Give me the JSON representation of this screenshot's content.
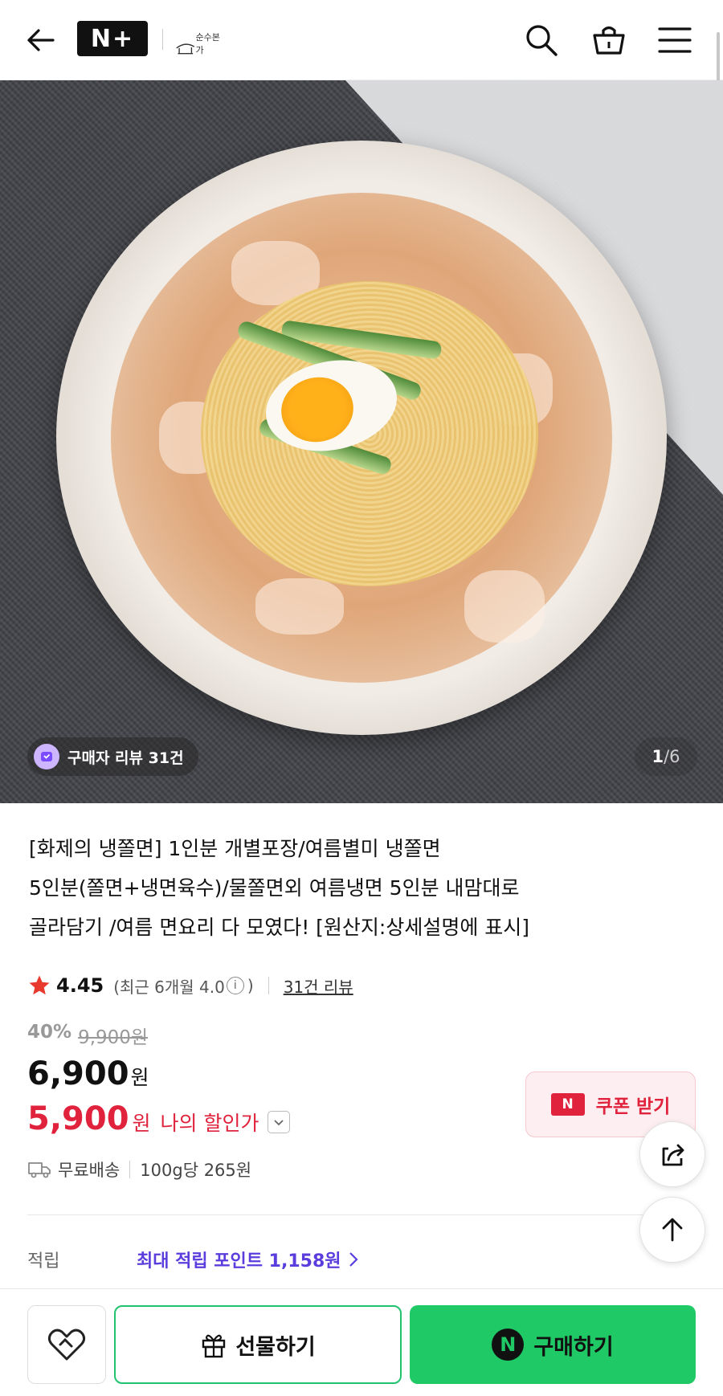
{
  "header": {
    "nplus_label": "N+",
    "store_logo_text": "순수본가",
    "icons": [
      "back-arrow-icon",
      "search-icon",
      "cart-icon",
      "menu-icon"
    ]
  },
  "hero": {
    "review_badge": "구매자 리뷰 31건",
    "counter_current": "1",
    "counter_total": "6"
  },
  "product": {
    "title_lines": [
      "[화제의 냉쫄면] 1인분 개별포장/여름별미 냉쫄면",
      "5인분(쫄면+냉면육수)/물쫄면외 여름냉면 5인분 내맘대로",
      "골라담기 /여름 면요리 다 모였다! [원산지:상세설명에 표시]"
    ],
    "rating": "4.45",
    "rating_recent_prefix": "(최근 6개월 4.0",
    "rating_recent_suffix": ")",
    "review_link": "31건 리뷰",
    "discount_rate": "40%",
    "original_price": "9,900원",
    "price": "6,900",
    "price_unit": "원",
    "my_price": "5,900",
    "my_price_unit": "원",
    "my_price_label": "나의 할인가",
    "delivery": "무료배송",
    "unit_price": "100g당 265원",
    "points_label": "적립",
    "points_value": "최대 적립 포인트 1,158원"
  },
  "coupon": {
    "badge": "N",
    "label": "쿠폰 받기"
  },
  "bottom_bar": {
    "gift_label": "선물하기",
    "buy_badge": "N",
    "buy_label": "구매하기"
  },
  "colors": {
    "accent_red": "#e0223c",
    "accent_green": "#1fc965",
    "points_purple": "#5b3dde"
  }
}
